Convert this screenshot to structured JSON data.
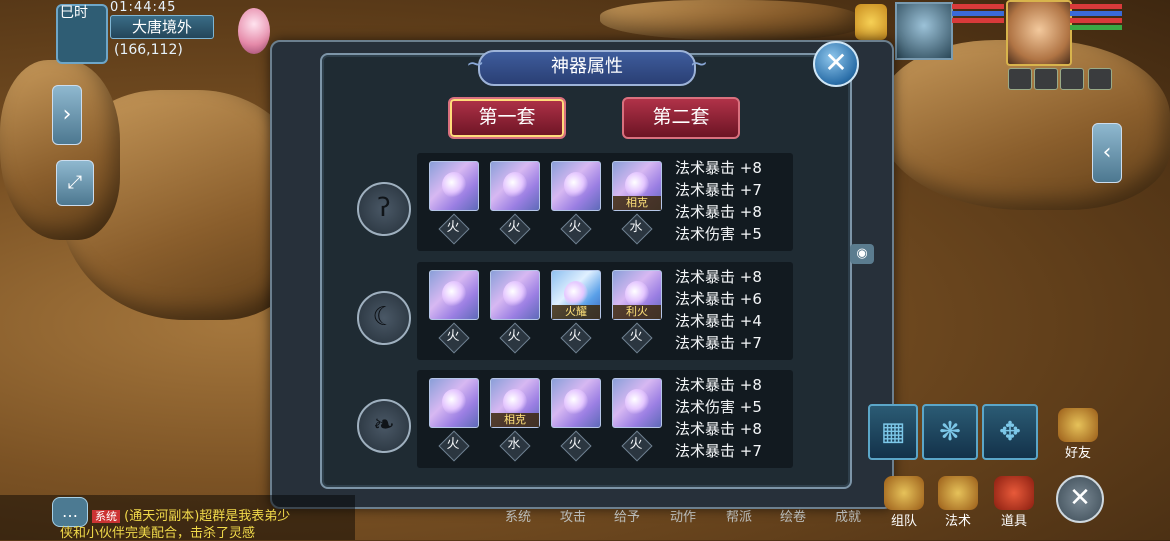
{
  "hud": {
    "tag": "巳时",
    "time": "01:44:45",
    "zone": "大唐境外",
    "coords": "(166,112)"
  },
  "panel": {
    "title": "神器属性",
    "close_symbol": "✕",
    "sets": [
      "第一套",
      "第二套"
    ],
    "rows": [
      {
        "icon": "hook-icon",
        "gems": [
          {
            "type": "purple",
            "tag": ""
          },
          {
            "type": "purple",
            "tag": ""
          },
          {
            "type": "purple",
            "tag": ""
          },
          {
            "type": "purple",
            "tag": "相克"
          }
        ],
        "elements": [
          "火",
          "火",
          "火",
          "水"
        ],
        "attrs": [
          "法术暴击 +8",
          "法术暴击 +7",
          "法术暴击 +8",
          "法术伤害 +5"
        ]
      },
      {
        "icon": "crescent-moon-icon",
        "gems": [
          {
            "type": "purple",
            "tag": ""
          },
          {
            "type": "purple",
            "tag": ""
          },
          {
            "type": "blue",
            "tag": "火耀"
          },
          {
            "type": "purple",
            "tag": "利火"
          }
        ],
        "elements": [
          "火",
          "火",
          "火",
          "火"
        ],
        "attrs": [
          "法术暴击 +8",
          "法术暴击 +6",
          "法术暴击 +4",
          "法术暴击 +7"
        ]
      },
      {
        "icon": "flame-wing-icon",
        "gems": [
          {
            "type": "purple",
            "tag": ""
          },
          {
            "type": "purple",
            "tag": "相克"
          },
          {
            "type": "purple",
            "tag": ""
          },
          {
            "type": "purple",
            "tag": ""
          }
        ],
        "elements": [
          "火",
          "水",
          "火",
          "火"
        ],
        "attrs": [
          "法术暴击 +8",
          "法术伤害 +5",
          "法术暴击 +8",
          "法术暴击 +7"
        ]
      }
    ]
  },
  "chat": {
    "sys_label": "系统",
    "line1": "(通天河副本)超群是我表弟少",
    "line2": "侠和小伙伴完美配合，击杀了灵感"
  },
  "bottom_menu": [
    "系统",
    "攻击",
    "给予",
    "动作",
    "帮派",
    "绘卷",
    "成就"
  ],
  "hotbar": [
    {
      "label": "好友"
    },
    {
      "label": "组队"
    },
    {
      "label": "法术"
    },
    {
      "label": "道具"
    }
  ],
  "colors": {
    "accent": "#b03248",
    "panel": "#1f2b33",
    "title": "#3e5c9c"
  }
}
